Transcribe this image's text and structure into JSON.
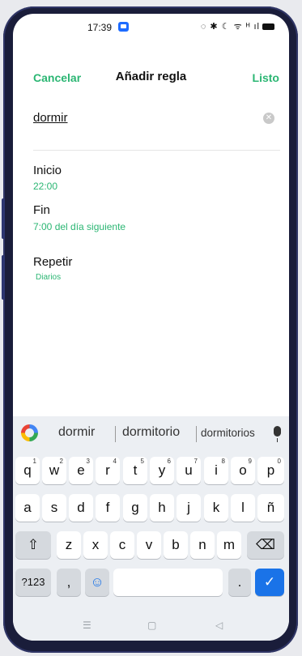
{
  "status": {
    "time": "17:39",
    "icons": "◌ ✱ ☾ ᯤ ᴴ ıl"
  },
  "header": {
    "cancel": "Cancelar",
    "title": "Añadir regla",
    "done": "Listo"
  },
  "rule": {
    "name": "dormir",
    "start_label": "Inicio",
    "start_value": "22:00",
    "end_label": "Fin",
    "end_value": "7:00 del día siguiente",
    "repeat_label": "Repetir",
    "repeat_value": "Diarios"
  },
  "keyboard": {
    "suggestions": [
      "dormir",
      "dormitorio",
      "dormitorios"
    ],
    "rows": [
      [
        "q",
        "w",
        "e",
        "r",
        "t",
        "y",
        "u",
        "i",
        "o",
        "p"
      ],
      [
        "a",
        "s",
        "d",
        "f",
        "g",
        "h",
        "j",
        "k",
        "l",
        "ñ"
      ],
      [
        "z",
        "x",
        "c",
        "v",
        "b",
        "n",
        "m"
      ]
    ],
    "numbers": [
      "1",
      "2",
      "3",
      "4",
      "5",
      "6",
      "7",
      "8",
      "9",
      "0"
    ],
    "mode_key": "?123",
    "comma": ",",
    "period": ".",
    "emoji": "☺",
    "shift": "⇧",
    "backspace": "⌫",
    "enter": "✓"
  },
  "nav": {
    "menu": "☰",
    "home": "▢",
    "back": "◁"
  },
  "colors": {
    "accent": "#2bb673",
    "enter": "#1a73e8"
  }
}
